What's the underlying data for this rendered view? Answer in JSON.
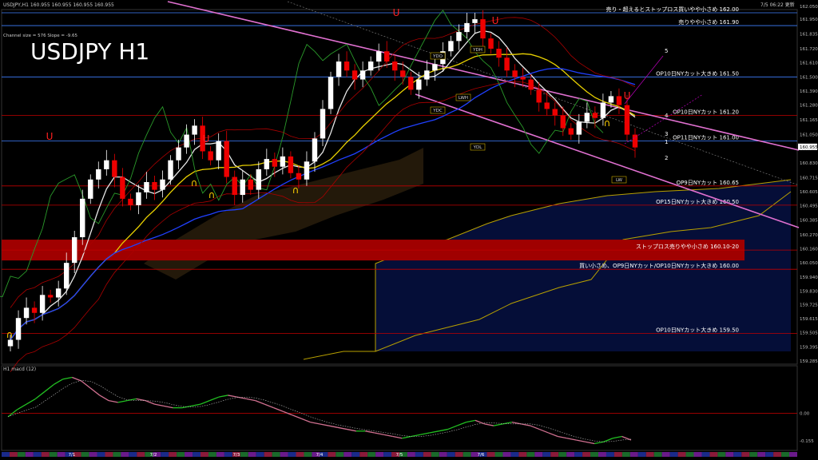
{
  "window": {
    "symbol_line": "USDJPY,H1  160.955 160.955 160.955 160.955",
    "timestamp": "7/5 06:22 更新",
    "overlay_title": "USDJPY H1",
    "channel_info": "Channel size = 576  Slope = -9.65"
  },
  "chart_data": {
    "type": "candlestick",
    "title": "USDJPY H1",
    "price_axis": [
      "162.050",
      "161.950",
      "161.835",
      "161.720",
      "161.610",
      "161.500",
      "161.390",
      "161.280",
      "161.165",
      "161.050",
      "160.940",
      "160.830",
      "160.715",
      "160.605",
      "160.495",
      "160.385",
      "160.270",
      "160.160",
      "160.050",
      "159.940",
      "159.830",
      "159.725",
      "159.615",
      "159.505",
      "159.395",
      "159.285"
    ],
    "current_price": "160.955",
    "date_labels": [
      "7/1",
      "7/2",
      "7/3",
      "7/4",
      "7/5",
      "7/6"
    ],
    "level_lines": [
      {
        "price": 162.0,
        "label": "売り・超えるとストップロス買いやや小さめ 162.00",
        "color": "#3f7fff"
      },
      {
        "price": 161.9,
        "label": "売りやや小さめ 161.90",
        "color": "#3f7fff"
      },
      {
        "price": 161.5,
        "label": "OP10日NYカット大きめ 161.50",
        "color": "#3f7fff"
      },
      {
        "price": 161.2,
        "label": "OP10日NYカット 161.20",
        "color": "#c00000"
      },
      {
        "price": 161.0,
        "label": "OP11日NYカット 161.00",
        "color": "#3f7fff"
      },
      {
        "price": 160.65,
        "label": "OP9日NYカット 160.65",
        "color": "#c00000"
      },
      {
        "price": 160.5,
        "label": "OP15日NYカット大きめ 160.50",
        "color": "#c00000"
      },
      {
        "price": 160.15,
        "label": "ストップロス売りやや小さめ 160.10-20",
        "color": "#c00000"
      },
      {
        "price": 160.0,
        "label": "買い小さめ、OP9日NYカット/OP10日NYカット大きめ 160.00",
        "color": "#c00000"
      },
      {
        "price": 159.5,
        "label": "OP10日NYカット大きめ 159.50",
        "color": "#c00000"
      }
    ],
    "stop_zone": {
      "from": 160.1,
      "to": 160.2
    },
    "ref_labels": [
      "YDH",
      "YDO",
      "YDC",
      "YDL",
      "LWH",
      "LW"
    ],
    "wave_labels": [
      "1",
      "2",
      "3",
      "4",
      "5"
    ],
    "macd_label": "H1  macd (12)",
    "macd_axis": [
      "0.00",
      "-0.155"
    ],
    "close_path": [
      159.45,
      159.62,
      159.7,
      159.66,
      159.8,
      159.78,
      159.85,
      160.05,
      160.25,
      160.55,
      160.7,
      160.78,
      160.85,
      160.72,
      160.55,
      160.5,
      160.6,
      160.68,
      160.62,
      160.7,
      160.85,
      160.95,
      161.05,
      161.12,
      160.92,
      160.85,
      161.0,
      160.72,
      160.58,
      160.7,
      160.62,
      160.78,
      160.86,
      160.8,
      160.88,
      160.75,
      160.7,
      160.84,
      161.02,
      161.25,
      161.5,
      161.62,
      161.55,
      161.48,
      161.55,
      161.62,
      161.7,
      161.62,
      161.55,
      161.5,
      161.4,
      161.48,
      161.55,
      161.6,
      161.7,
      161.78,
      161.85,
      161.92,
      161.95,
      161.8,
      161.72,
      161.65,
      161.55,
      161.5,
      161.48,
      161.4,
      161.3,
      161.25,
      161.2,
      161.1,
      161.05,
      161.15,
      161.22,
      161.18,
      161.3,
      161.35,
      161.28,
      161.05,
      160.95
    ],
    "macd_path": [
      -0.02,
      0.02,
      0.05,
      0.08,
      0.12,
      0.16,
      0.19,
      0.2,
      0.18,
      0.14,
      0.1,
      0.07,
      0.06,
      0.07,
      0.08,
      0.07,
      0.05,
      0.04,
      0.03,
      0.03,
      0.04,
      0.05,
      0.07,
      0.09,
      0.1,
      0.09,
      0.08,
      0.07,
      0.05,
      0.03,
      0.01,
      -0.01,
      -0.03,
      -0.05,
      -0.06,
      -0.07,
      -0.08,
      -0.09,
      -0.1,
      -0.1,
      -0.11,
      -0.12,
      -0.13,
      -0.14,
      -0.13,
      -0.12,
      -0.11,
      -0.1,
      -0.09,
      -0.07,
      -0.05,
      -0.04,
      -0.06,
      -0.07,
      -0.06,
      -0.05,
      -0.06,
      -0.07,
      -0.09,
      -0.11,
      -0.13,
      -0.14,
      -0.15,
      -0.16,
      -0.17,
      -0.16,
      -0.14,
      -0.13,
      -0.15
    ]
  }
}
